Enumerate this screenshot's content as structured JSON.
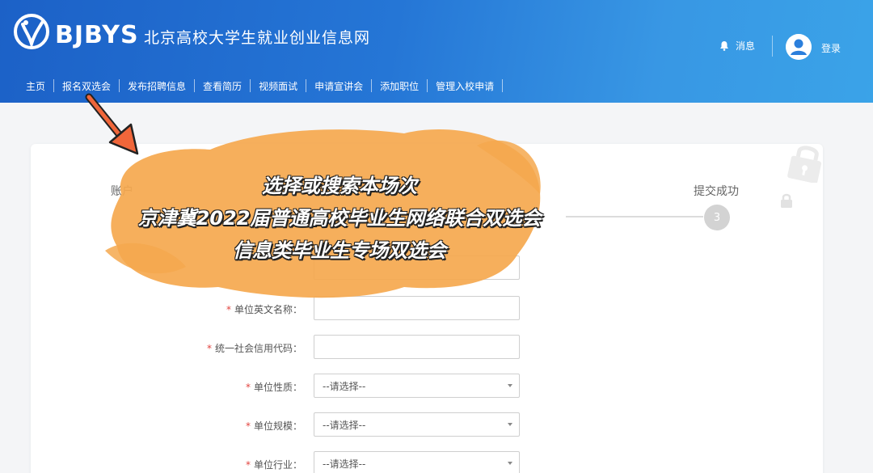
{
  "brand": {
    "name": "BJBYS",
    "subtitle": "北京高校大学生就业创业信息网"
  },
  "header": {
    "messages_label": "消息",
    "login_label": "登录"
  },
  "nav": [
    {
      "label": "主页"
    },
    {
      "label": "报名双选会"
    },
    {
      "label": "发布招聘信息"
    },
    {
      "label": "查看简历"
    },
    {
      "label": "视频面试"
    },
    {
      "label": "申请宣讲会"
    },
    {
      "label": "添加职位"
    },
    {
      "label": "管理入校申请"
    }
  ],
  "steps": {
    "step1_visible": "账户",
    "step3_label": "提交成功",
    "step3_number": "3"
  },
  "form": {
    "unit_en_name_label": "单位英文名称：",
    "credit_code_label": "统一社会信用代码：",
    "unit_nature_label": "单位性质：",
    "unit_scale_label": "单位规模：",
    "unit_industry_label": "单位行业：",
    "select_placeholder": "--请选择--",
    "required_mark": "*"
  },
  "overlay": {
    "line1": "选择或搜索本场次",
    "line2": "京津冀2022届普通高校毕业生网络联合双选会",
    "line3": "信息类毕业生专场双选会"
  },
  "colors": {
    "header_start": "#1c61c7",
    "header_end": "#3aa3e8",
    "blob": "#f5a84e",
    "arrow": "#f0663a",
    "required": "#e2443f"
  }
}
